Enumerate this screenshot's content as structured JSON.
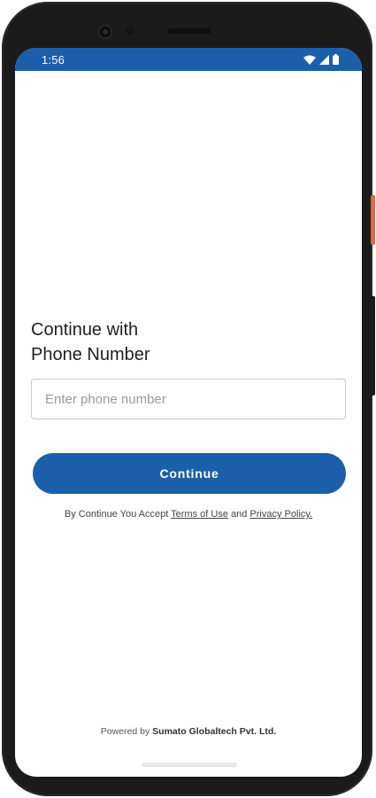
{
  "status_bar": {
    "time": "1:56",
    "color": "#1b5fab",
    "icons": [
      "wifi-icon",
      "signal-icon",
      "battery-icon"
    ]
  },
  "login": {
    "title_line1": "Continue with",
    "title_line2": "Phone Number",
    "phone_placeholder": "Enter phone number",
    "phone_value": "",
    "continue_label": "Continue",
    "terms_prefix": "By Continue You Accept ",
    "terms_link": "Terms of Use",
    "terms_and": " and ",
    "privacy_link": "Privacy Policy."
  },
  "footer": {
    "powered_prefix": "Powered by ",
    "company": "Sumato Globaltech Pvt. Ltd."
  },
  "colors": {
    "accent": "#1b5fab",
    "frame": "#1b1b1b",
    "power_button": "#e06a3f"
  }
}
